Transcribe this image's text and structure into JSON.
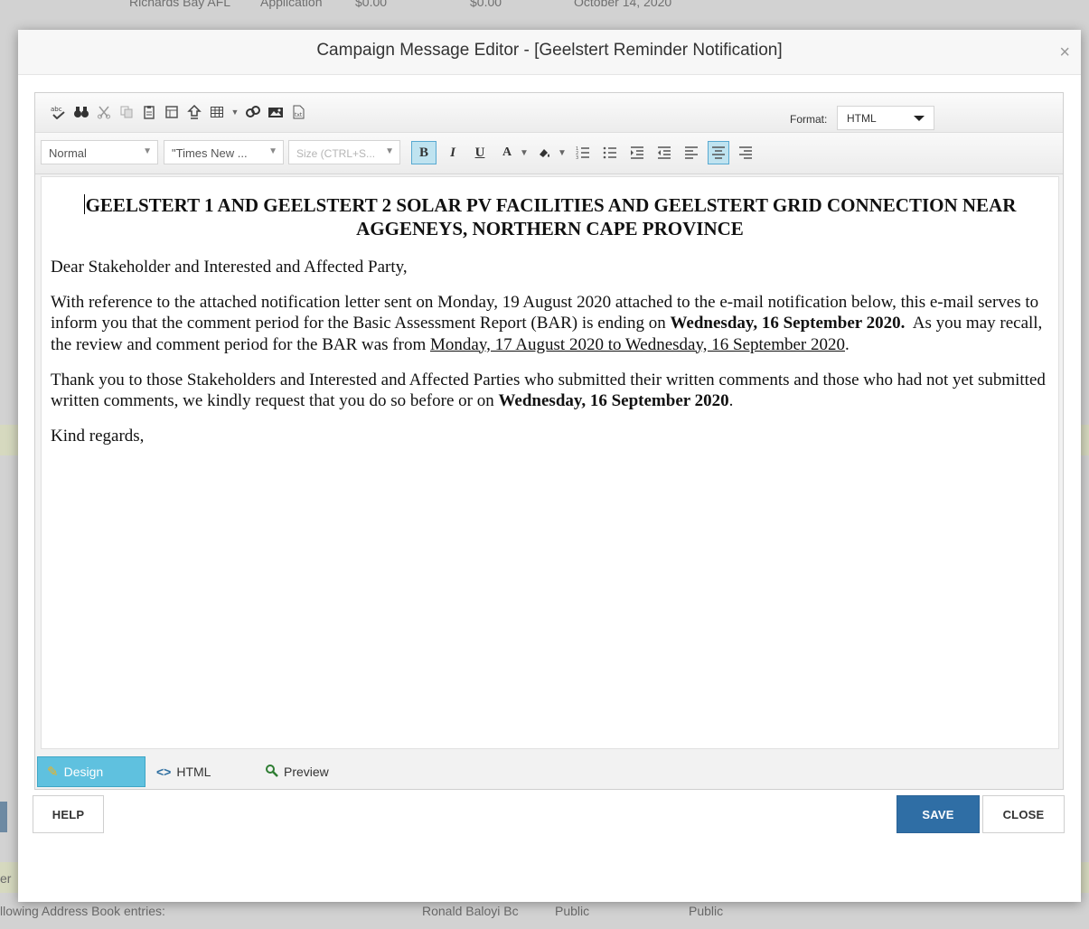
{
  "background": {
    "top_row": [
      "Richards Bay AFL",
      "Application",
      "$0.00",
      "$0.00",
      "October 14, 2020"
    ],
    "bottom_label": "llowing Address Book entries:",
    "bottom_name": "Ronald Baloyi Bc",
    "bottom_public_1": "Public",
    "bottom_public_2": "Public",
    "side_text": "er"
  },
  "modal": {
    "title": "Campaign Message Editor - [Geelstert Reminder Notification]",
    "close_glyph": "×"
  },
  "toolbar": {
    "format_label": "Format:",
    "format_value": "HTML",
    "paragraph_style": "Normal",
    "font_name": "\"Times New ...",
    "size_placeholder": "Size (CTRL+S...",
    "bold": "B",
    "italic": "I",
    "underline": "U",
    "font_color": "A"
  },
  "document": {
    "heading": "GEELSTERT 1 AND GEELSTERT 2 SOLAR PV FACILITIES AND GEELSTERT GRID CONNECTION NEAR AGGENEYS, NORTHERN CAPE PROVINCE",
    "greeting": "Dear Stakeholder and Interested and Affected Party,",
    "p1_a": "With reference to the attached notification letter sent on Monday, 19 August 2020 attached to the e-mail notification below, this e-mail serves to inform you that the comment period for the Basic Assessment Report (BAR) is ending on ",
    "p1_bold": "Wednesday, 16 September 2020.",
    "p1_b": "  As you may recall, the review and comment period for the BAR was from ",
    "p1_underline": "Monday, 17 August 2020 to Wednesday, 16 September 2020",
    "p1_end": ".",
    "p2_a": "Thank you to those Stakeholders and Interested and Affected Parties who submitted their written comments and those who had not yet submitted written comments, we kindly request that you do so before or on ",
    "p2_bold": "Wednesday, 16 September 2020",
    "p2_end": ".",
    "closing": "Kind regards,"
  },
  "modes": {
    "design": "Design",
    "html": "HTML",
    "preview": "Preview"
  },
  "buttons": {
    "help": "HELP",
    "save": "SAVE",
    "close": "CLOSE"
  }
}
